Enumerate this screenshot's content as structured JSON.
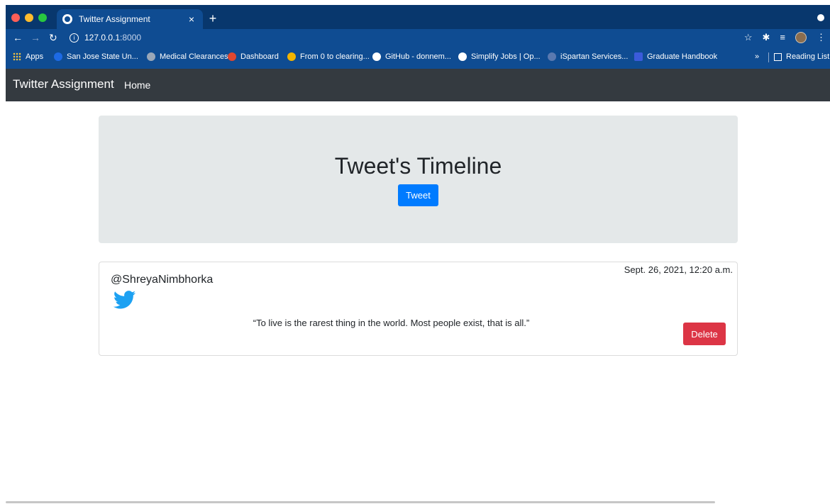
{
  "browser": {
    "tab_title": "Twitter Assignment",
    "tab_close": "×",
    "new_tab": "+",
    "url_host": "127.0.0.1",
    "url_port": ":8000",
    "bookmarks": [
      {
        "label": "Apps",
        "icon": "apps-grid-icon"
      },
      {
        "label": "San Jose State Un...",
        "icon": "sjsu-icon",
        "color": "#1d6ae5"
      },
      {
        "label": "Medical Clearances",
        "icon": "medical-icon",
        "color": "#9aa7b8"
      },
      {
        "label": "Dashboard",
        "icon": "dashboard-icon",
        "color": "#e0472f"
      },
      {
        "label": "From 0 to clearing...",
        "icon": "hashnode-icon",
        "color": "#f2b400"
      },
      {
        "label": "GitHub - donnem...",
        "icon": "github-icon",
        "color": "#ffffff"
      },
      {
        "label": "Simplify Jobs | Op...",
        "icon": "simplify-icon",
        "color": "#ffffff"
      },
      {
        "label": "iSpartan Services...",
        "icon": "ispartan-icon",
        "color": "#5a79b0"
      },
      {
        "label": "Graduate Handbook",
        "icon": "handbook-icon",
        "color": "#3b5bdb"
      }
    ],
    "overflow": "»",
    "reading_list": "Reading List"
  },
  "navbar": {
    "brand": "Twitter Assignment",
    "home": "Home"
  },
  "hero": {
    "title": "Tweet's Timeline",
    "button": "Tweet"
  },
  "tweet": {
    "handle": "@ShreyaNimbhorka",
    "timestamp": "Sept. 26, 2021, 12:20 a.m.",
    "text": "“To live is the rarest thing in the world. Most people exist, that is all.”",
    "delete": "Delete"
  },
  "colors": {
    "primary": "#007bff",
    "danger": "#dc3545",
    "navbar": "#343a40",
    "jumbotron": "#e4e8e9",
    "twitter_blue": "#1da1f2"
  }
}
